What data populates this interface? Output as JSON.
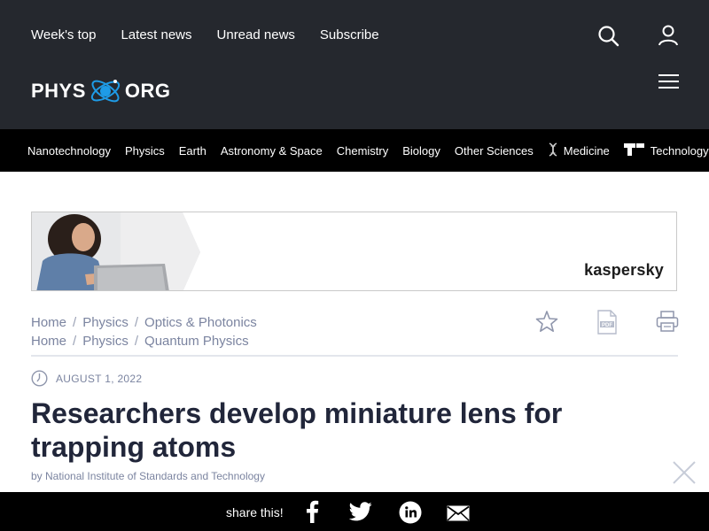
{
  "header": {
    "top_links": [
      "Week's top",
      "Latest news",
      "Unread news",
      "Subscribe"
    ],
    "logo_left": "PHYS",
    "logo_right": "ORG",
    "icons": [
      "search-icon",
      "user-icon",
      "hamburger-menu-icon"
    ]
  },
  "categories": [
    {
      "label": "Nanotechnology",
      "icon": null
    },
    {
      "label": "Physics",
      "icon": null
    },
    {
      "label": "Earth",
      "icon": null
    },
    {
      "label": "Astronomy & Space",
      "icon": null
    },
    {
      "label": "Chemistry",
      "icon": null
    },
    {
      "label": "Biology",
      "icon": null
    },
    {
      "label": "Other Sciences",
      "icon": null
    },
    {
      "label": "Medicine",
      "icon": "dna-icon"
    },
    {
      "label": "Technology",
      "icon": "techxplore-icon"
    }
  ],
  "ad": {
    "brand": "kaspersky"
  },
  "breadcrumbs": [
    [
      "Home",
      "Physics",
      "Optics & Photonics"
    ],
    [
      "Home",
      "Physics",
      "Quantum Physics"
    ]
  ],
  "article": {
    "date": "AUGUST 1, 2022",
    "title": "Researchers develop miniature lens for trapping atoms",
    "byline": "by National Institute of Standards and Technology"
  },
  "share": {
    "label": "share this!",
    "icons": [
      "facebook-icon",
      "twitter-icon",
      "linkedin-icon",
      "email-icon"
    ]
  },
  "colors": {
    "header_bg": "#25282e",
    "nav_bg": "#000000",
    "accent": "#1e9be6",
    "muted_text": "#7b84a0",
    "headline": "#21263a"
  }
}
